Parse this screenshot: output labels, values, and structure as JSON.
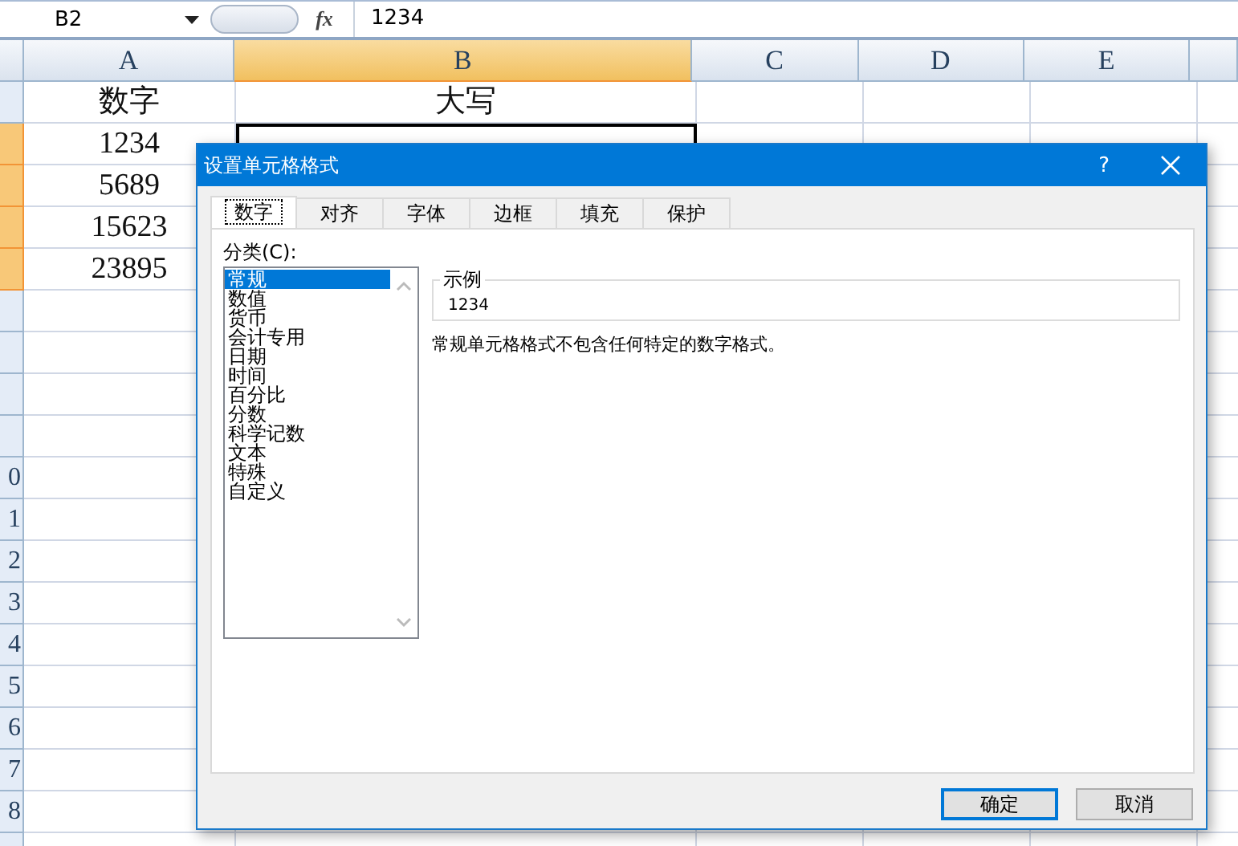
{
  "formula_bar": {
    "name_box": "B2",
    "function_label": "fx",
    "formula": "1234"
  },
  "columns": [
    {
      "label": "A",
      "selected": false
    },
    {
      "label": "B",
      "selected": true
    },
    {
      "label": "C",
      "selected": false
    },
    {
      "label": "D",
      "selected": false
    },
    {
      "label": "E",
      "selected": false
    }
  ],
  "rows": [
    {
      "selected": false,
      "cells": [
        {
          "text": "数字",
          "active": false
        },
        {
          "text": "大写",
          "active": false
        }
      ]
    },
    {
      "selected": true,
      "cells": [
        {
          "text": "1234",
          "active": false
        },
        {
          "active": true
        }
      ]
    },
    {
      "selected": true,
      "cells": [
        {
          "text": "5689",
          "active": false
        }
      ]
    },
    {
      "selected": true,
      "cells": [
        {
          "text": "15623",
          "active": false
        }
      ]
    },
    {
      "selected": true,
      "cells": [
        {
          "text": "23895",
          "active": false
        }
      ]
    },
    {
      "selected": false
    },
    {
      "selected": false
    },
    {
      "selected": false
    },
    {
      "selected": false
    },
    {
      "header": "0",
      "selected": false
    },
    {
      "header": "1",
      "selected": false
    },
    {
      "header": "2",
      "selected": false
    },
    {
      "header": "3",
      "selected": false
    },
    {
      "header": "4",
      "selected": false
    },
    {
      "header": "5",
      "selected": false
    },
    {
      "header": "6",
      "selected": false
    },
    {
      "header": "7",
      "selected": false
    },
    {
      "header": "8",
      "selected": false
    },
    {
      "selected": false
    }
  ],
  "dialog": {
    "title": "设置单元格格式",
    "help": "?",
    "tabs": [
      {
        "label": "数字",
        "selected": true
      },
      {
        "label": "对齐",
        "selected": false
      },
      {
        "label": "字体",
        "selected": false
      },
      {
        "label": "边框",
        "selected": false
      },
      {
        "label": "填充",
        "selected": false
      },
      {
        "label": "保护",
        "selected": false
      }
    ],
    "category_label": "分类(C):",
    "categories": [
      {
        "label": "常规",
        "selected": true
      },
      {
        "label": "数值",
        "selected": false
      },
      {
        "label": "货币",
        "selected": false
      },
      {
        "label": "会计专用",
        "selected": false
      },
      {
        "label": "日期",
        "selected": false
      },
      {
        "label": "时间",
        "selected": false
      },
      {
        "label": "百分比",
        "selected": false
      },
      {
        "label": "分数",
        "selected": false
      },
      {
        "label": "科学记数",
        "selected": false
      },
      {
        "label": "文本",
        "selected": false
      },
      {
        "label": "特殊",
        "selected": false
      },
      {
        "label": "自定义",
        "selected": false
      }
    ],
    "sample_label": "示例",
    "sample_value": "1234",
    "description": "常规单元格格式不包含任何特定的数字格式。",
    "buttons": [
      {
        "label": "确定",
        "default": true
      },
      {
        "label": "取消",
        "default": false
      }
    ]
  }
}
